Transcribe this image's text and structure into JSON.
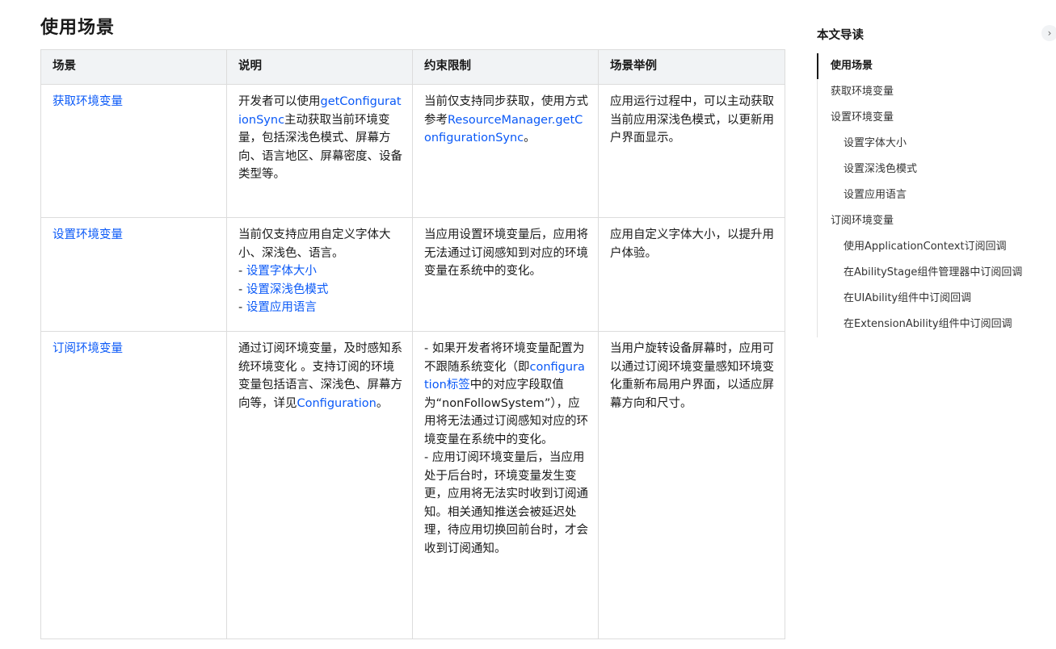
{
  "page_title": "使用场景",
  "table": {
    "headers": [
      "场景",
      "说明",
      "约束限制",
      "场景举例"
    ],
    "rows": [
      {
        "scene": "获取环境变量",
        "desc": {
          "pre": "开发者可以使用",
          "link": "getConfigurationSync",
          "post": "主动获取当前环境变量，包括深浅色模式、屏幕方向、语言地区、屏幕密度、设备类型等。"
        },
        "constraint": {
          "pre": "当前仅支持同步获取，使用方式参考",
          "link": "ResourceManager.getConfigurationSync",
          "post": "。"
        },
        "example": "应用运行过程中，可以主动获取当前应用深浅色模式，以更新用户界面显示。"
      },
      {
        "scene": "设置环境变量",
        "desc": {
          "text": "当前仅支持应用自定义字体大小、深浅色、语言。",
          "items": [
            "设置字体大小",
            "设置深浅色模式",
            "设置应用语言"
          ]
        },
        "constraint": "当应用设置环境变量后，应用将无法通过订阅感知到对应的环境变量在系统中的变化。",
        "example": "应用自定义字体大小，以提升用户体验。"
      },
      {
        "scene": "订阅环境变量",
        "desc": {
          "pre": "通过订阅环境变量，及时感知系统环境变化 。支持订阅的环境变量包括语言、深浅色、屏幕方向等，详见",
          "link": "Configuration",
          "post": "。"
        },
        "constraint": {
          "c1_pre": "- 如果开发者将环境变量配置为不跟随系统变化（即",
          "c1_link": "configuration标签",
          "c1_post": "中的对应字段取值为“nonFollowSystem”），应用将无法通过订阅感知对应的环境变量在系统中的变化。",
          "c2": "- 应用订阅环境变量后，当应用处于后台时，环境变量发生变更，应用将无法实时收到订阅通知。相关通知推送会被延迟处理，待应用切换回前台时，才会收到订阅通知。"
        },
        "example": "当用户旋转设备屏幕时，应用可以通过订阅环境变量感知环境变化重新布局用户界面，以适应屏幕方向和尺寸。"
      }
    ]
  },
  "toc": {
    "title": "本文导读",
    "toggle_icon": "chevron-right-icon",
    "toggle_glyph": "›",
    "items": [
      {
        "label": "使用场景",
        "level": 1,
        "active": true
      },
      {
        "label": "获取环境变量",
        "level": 1
      },
      {
        "label": "设置环境变量",
        "level": 1
      },
      {
        "label": "设置字体大小",
        "level": 2
      },
      {
        "label": "设置深浅色模式",
        "level": 2
      },
      {
        "label": "设置应用语言",
        "level": 2
      },
      {
        "label": "订阅环境变量",
        "level": 1
      },
      {
        "label": "使用ApplicationContext订阅回调",
        "level": 2
      },
      {
        "label": "在AbilityStage组件管理器中订阅回调",
        "level": 2
      },
      {
        "label": "在UIAbility组件中订阅回调",
        "level": 2
      },
      {
        "label": "在ExtensionAbility组件中订阅回调",
        "level": 2
      }
    ]
  },
  "colors": {
    "link": "#0a59f7",
    "header_bg": "#f1f3f5",
    "border": "#dcdcdc"
  }
}
